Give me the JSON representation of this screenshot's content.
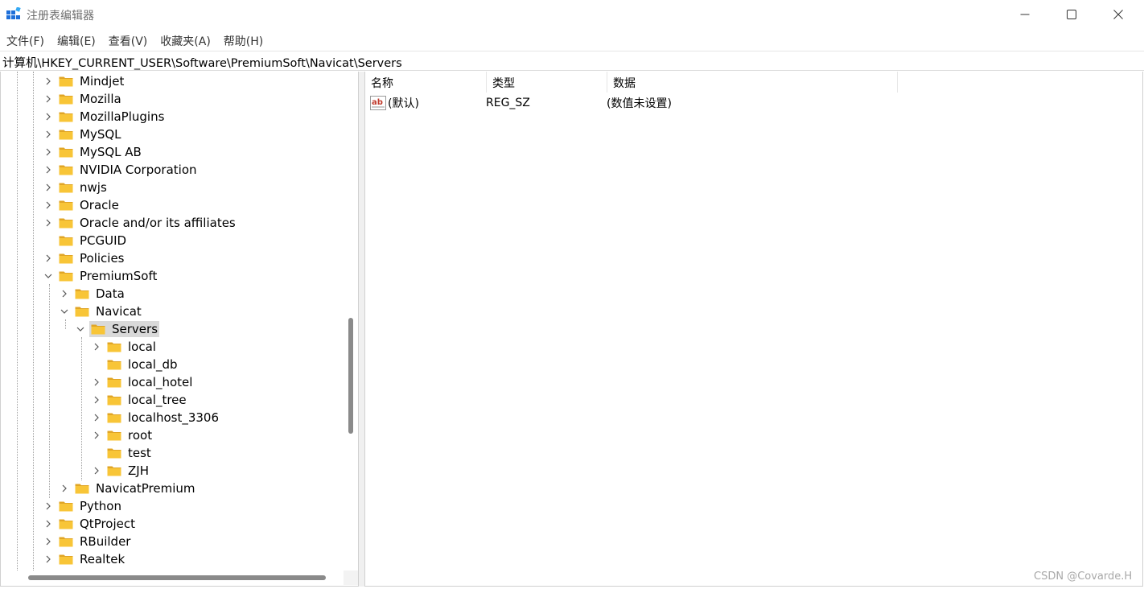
{
  "window": {
    "title": "注册表编辑器",
    "app_icon": "registry-editor-icon",
    "minimize_icon": "minimize-icon",
    "maximize_icon": "maximize-icon",
    "close_icon": "close-icon"
  },
  "menu": [
    "文件(F)",
    "编辑(E)",
    "查看(V)",
    "收藏夹(A)",
    "帮助(H)"
  ],
  "address": "计算机\\HKEY_CURRENT_USER\\Software\\PremiumSoft\\Navicat\\Servers",
  "tree": [
    {
      "label": "Mindjet",
      "expander": "collapsed"
    },
    {
      "label": "Mozilla",
      "expander": "collapsed"
    },
    {
      "label": "MozillaPlugins",
      "expander": "collapsed"
    },
    {
      "label": "MySQL",
      "expander": "collapsed"
    },
    {
      "label": "MySQL AB",
      "expander": "collapsed"
    },
    {
      "label": "NVIDIA Corporation",
      "expander": "collapsed"
    },
    {
      "label": "nwjs",
      "expander": "collapsed"
    },
    {
      "label": "Oracle",
      "expander": "collapsed"
    },
    {
      "label": "Oracle and/or its affiliates",
      "expander": "collapsed"
    },
    {
      "label": "PCGUID",
      "expander": "none"
    },
    {
      "label": "Policies",
      "expander": "collapsed"
    },
    {
      "label": "PremiumSoft",
      "expander": "expanded"
    },
    {
      "label": "Data",
      "expander": "collapsed"
    },
    {
      "label": "Navicat",
      "expander": "expanded"
    },
    {
      "label": "Servers",
      "expander": "expanded",
      "selected": true
    },
    {
      "label": "local",
      "expander": "collapsed"
    },
    {
      "label": "local_db",
      "expander": "none"
    },
    {
      "label": "local_hotel",
      "expander": "collapsed"
    },
    {
      "label": "local_tree",
      "expander": "collapsed"
    },
    {
      "label": "localhost_3306",
      "expander": "collapsed"
    },
    {
      "label": "root",
      "expander": "collapsed"
    },
    {
      "label": "test",
      "expander": "none"
    },
    {
      "label": "ZJH",
      "expander": "collapsed"
    },
    {
      "label": "NavicatPremium",
      "expander": "collapsed"
    },
    {
      "label": "Python",
      "expander": "collapsed"
    },
    {
      "label": "QtProject",
      "expander": "collapsed"
    },
    {
      "label": "RBuilder",
      "expander": "collapsed"
    },
    {
      "label": "Realtek",
      "expander": "collapsed"
    }
  ],
  "list": {
    "headers": {
      "name": "名称",
      "type": "类型",
      "data": "数据"
    },
    "rows": [
      {
        "icon": "string-value-ab-icon",
        "name": "(默认)",
        "type": "REG_SZ",
        "data": "(数值未设置)"
      }
    ]
  },
  "watermark": "CSDN @Covarde.H",
  "colors": {
    "folder": "#f8c537",
    "folder_dark": "#e0a526",
    "selection": "#d9d9d9",
    "scrollbar": "#8a8a8a"
  }
}
